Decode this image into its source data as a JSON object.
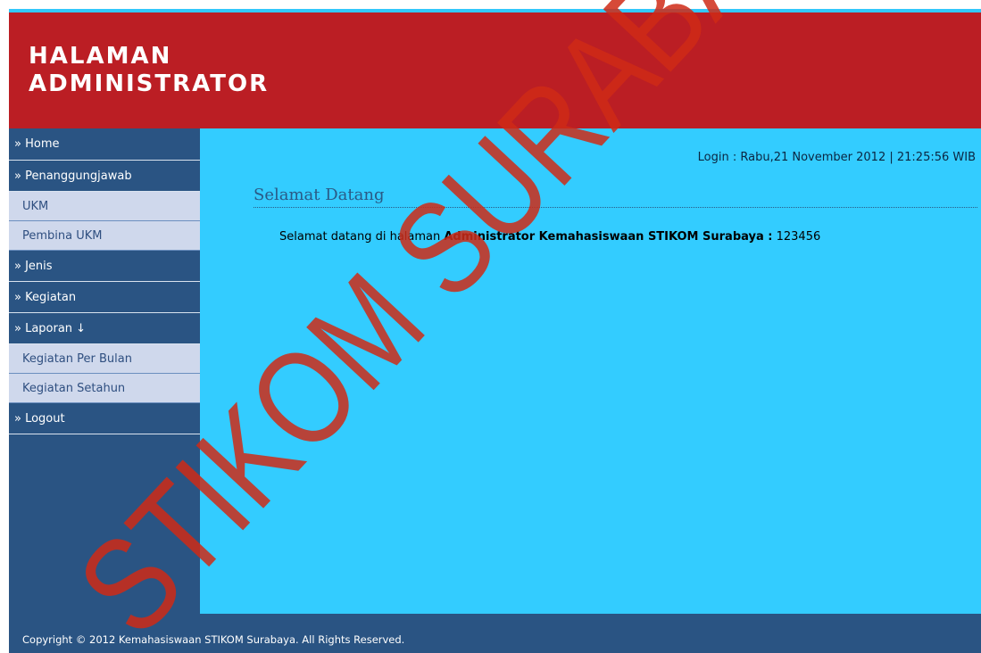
{
  "header": {
    "title_line1": "HALAMAN",
    "title_line2": "ADMINISTRATOR"
  },
  "sidebar": {
    "items": [
      {
        "label": "» Home",
        "type": "main"
      },
      {
        "label": "» Penanggungjawab",
        "type": "main"
      },
      {
        "label": "UKM",
        "type": "sub"
      },
      {
        "label": "Pembina UKM",
        "type": "sub"
      },
      {
        "label": "» Jenis",
        "type": "main"
      },
      {
        "label": "» Kegiatan",
        "type": "main"
      },
      {
        "label": "» Laporan ↓",
        "type": "main"
      },
      {
        "label": "Kegiatan Per Bulan",
        "type": "sub"
      },
      {
        "label": "Kegiatan Setahun",
        "type": "sub"
      },
      {
        "label": "» Logout",
        "type": "main"
      }
    ]
  },
  "main": {
    "login_info": "Login : Rabu,21 November 2012 | 21:25:56 WIB",
    "welcome_title": "Selamat Datang",
    "welcome_prefix": "Selamat datang di halaman ",
    "welcome_bold": "Administrator Kemahasiswaan STIKOM Surabaya :",
    "welcome_suffix": " 123456"
  },
  "footer": {
    "copyright": "Copyright © 2012 Kemahasiswaan STIKOM Surabaya. All Rights Reserved."
  },
  "watermark": {
    "text": "STIKOM SURABAYA",
    "color": "#cf2a16"
  },
  "colors": {
    "header_bg": "#bb1e24",
    "sidebar_bg": "#2a5483",
    "sub_item_bg": "#cfd8ec",
    "main_bg": "#33ccff",
    "accent_strip": "#33c8fb"
  }
}
